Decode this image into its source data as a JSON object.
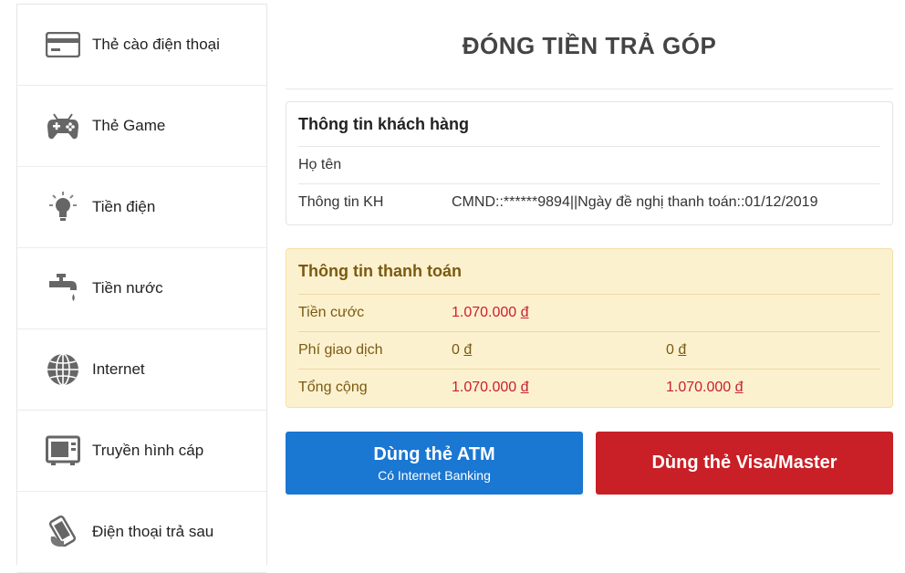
{
  "sidebar": {
    "items": [
      {
        "label": "Thẻ cào điện thoại",
        "icon": "credit-card-icon"
      },
      {
        "label": "Thẻ Game",
        "icon": "gamepad-icon"
      },
      {
        "label": "Tiền điện",
        "icon": "lightbulb-icon"
      },
      {
        "label": "Tiền nước",
        "icon": "faucet-icon"
      },
      {
        "label": "Internet",
        "icon": "globe-icon"
      },
      {
        "label": "Truyền hình cáp",
        "icon": "tv-icon"
      },
      {
        "label": "Điện thoại trả sau",
        "icon": "phone-icon"
      }
    ]
  },
  "main": {
    "title": "ĐÓNG TIỀN TRẢ GÓP",
    "customer": {
      "heading": "Thông tin khách hàng",
      "rows": [
        {
          "key": "Họ tên",
          "value": ""
        },
        {
          "key": "Thông tin KH",
          "value": "CMND::******9894||Ngày đề nghị thanh toán::01/12/2019"
        }
      ]
    },
    "payment": {
      "heading": "Thông tin thanh toán",
      "rows": [
        {
          "key": "Tiền cước",
          "v1": "1.070.000",
          "v2": ""
        },
        {
          "key": "Phí giao dịch",
          "v1": "0",
          "v2": "0"
        },
        {
          "key": "Tổng cộng",
          "v1": "1.070.000",
          "v2": "1.070.000"
        }
      ],
      "currency": "đ"
    },
    "buttons": {
      "atm_label": "Dùng thẻ ATM",
      "atm_sub": "Có Internet Banking",
      "visa_label": "Dùng thẻ Visa/Master"
    }
  },
  "colors": {
    "primary_button": "#1a77d2",
    "danger_button": "#c91f26",
    "payment_bg": "#fcf1cf",
    "amount_red": "#c9202f"
  }
}
